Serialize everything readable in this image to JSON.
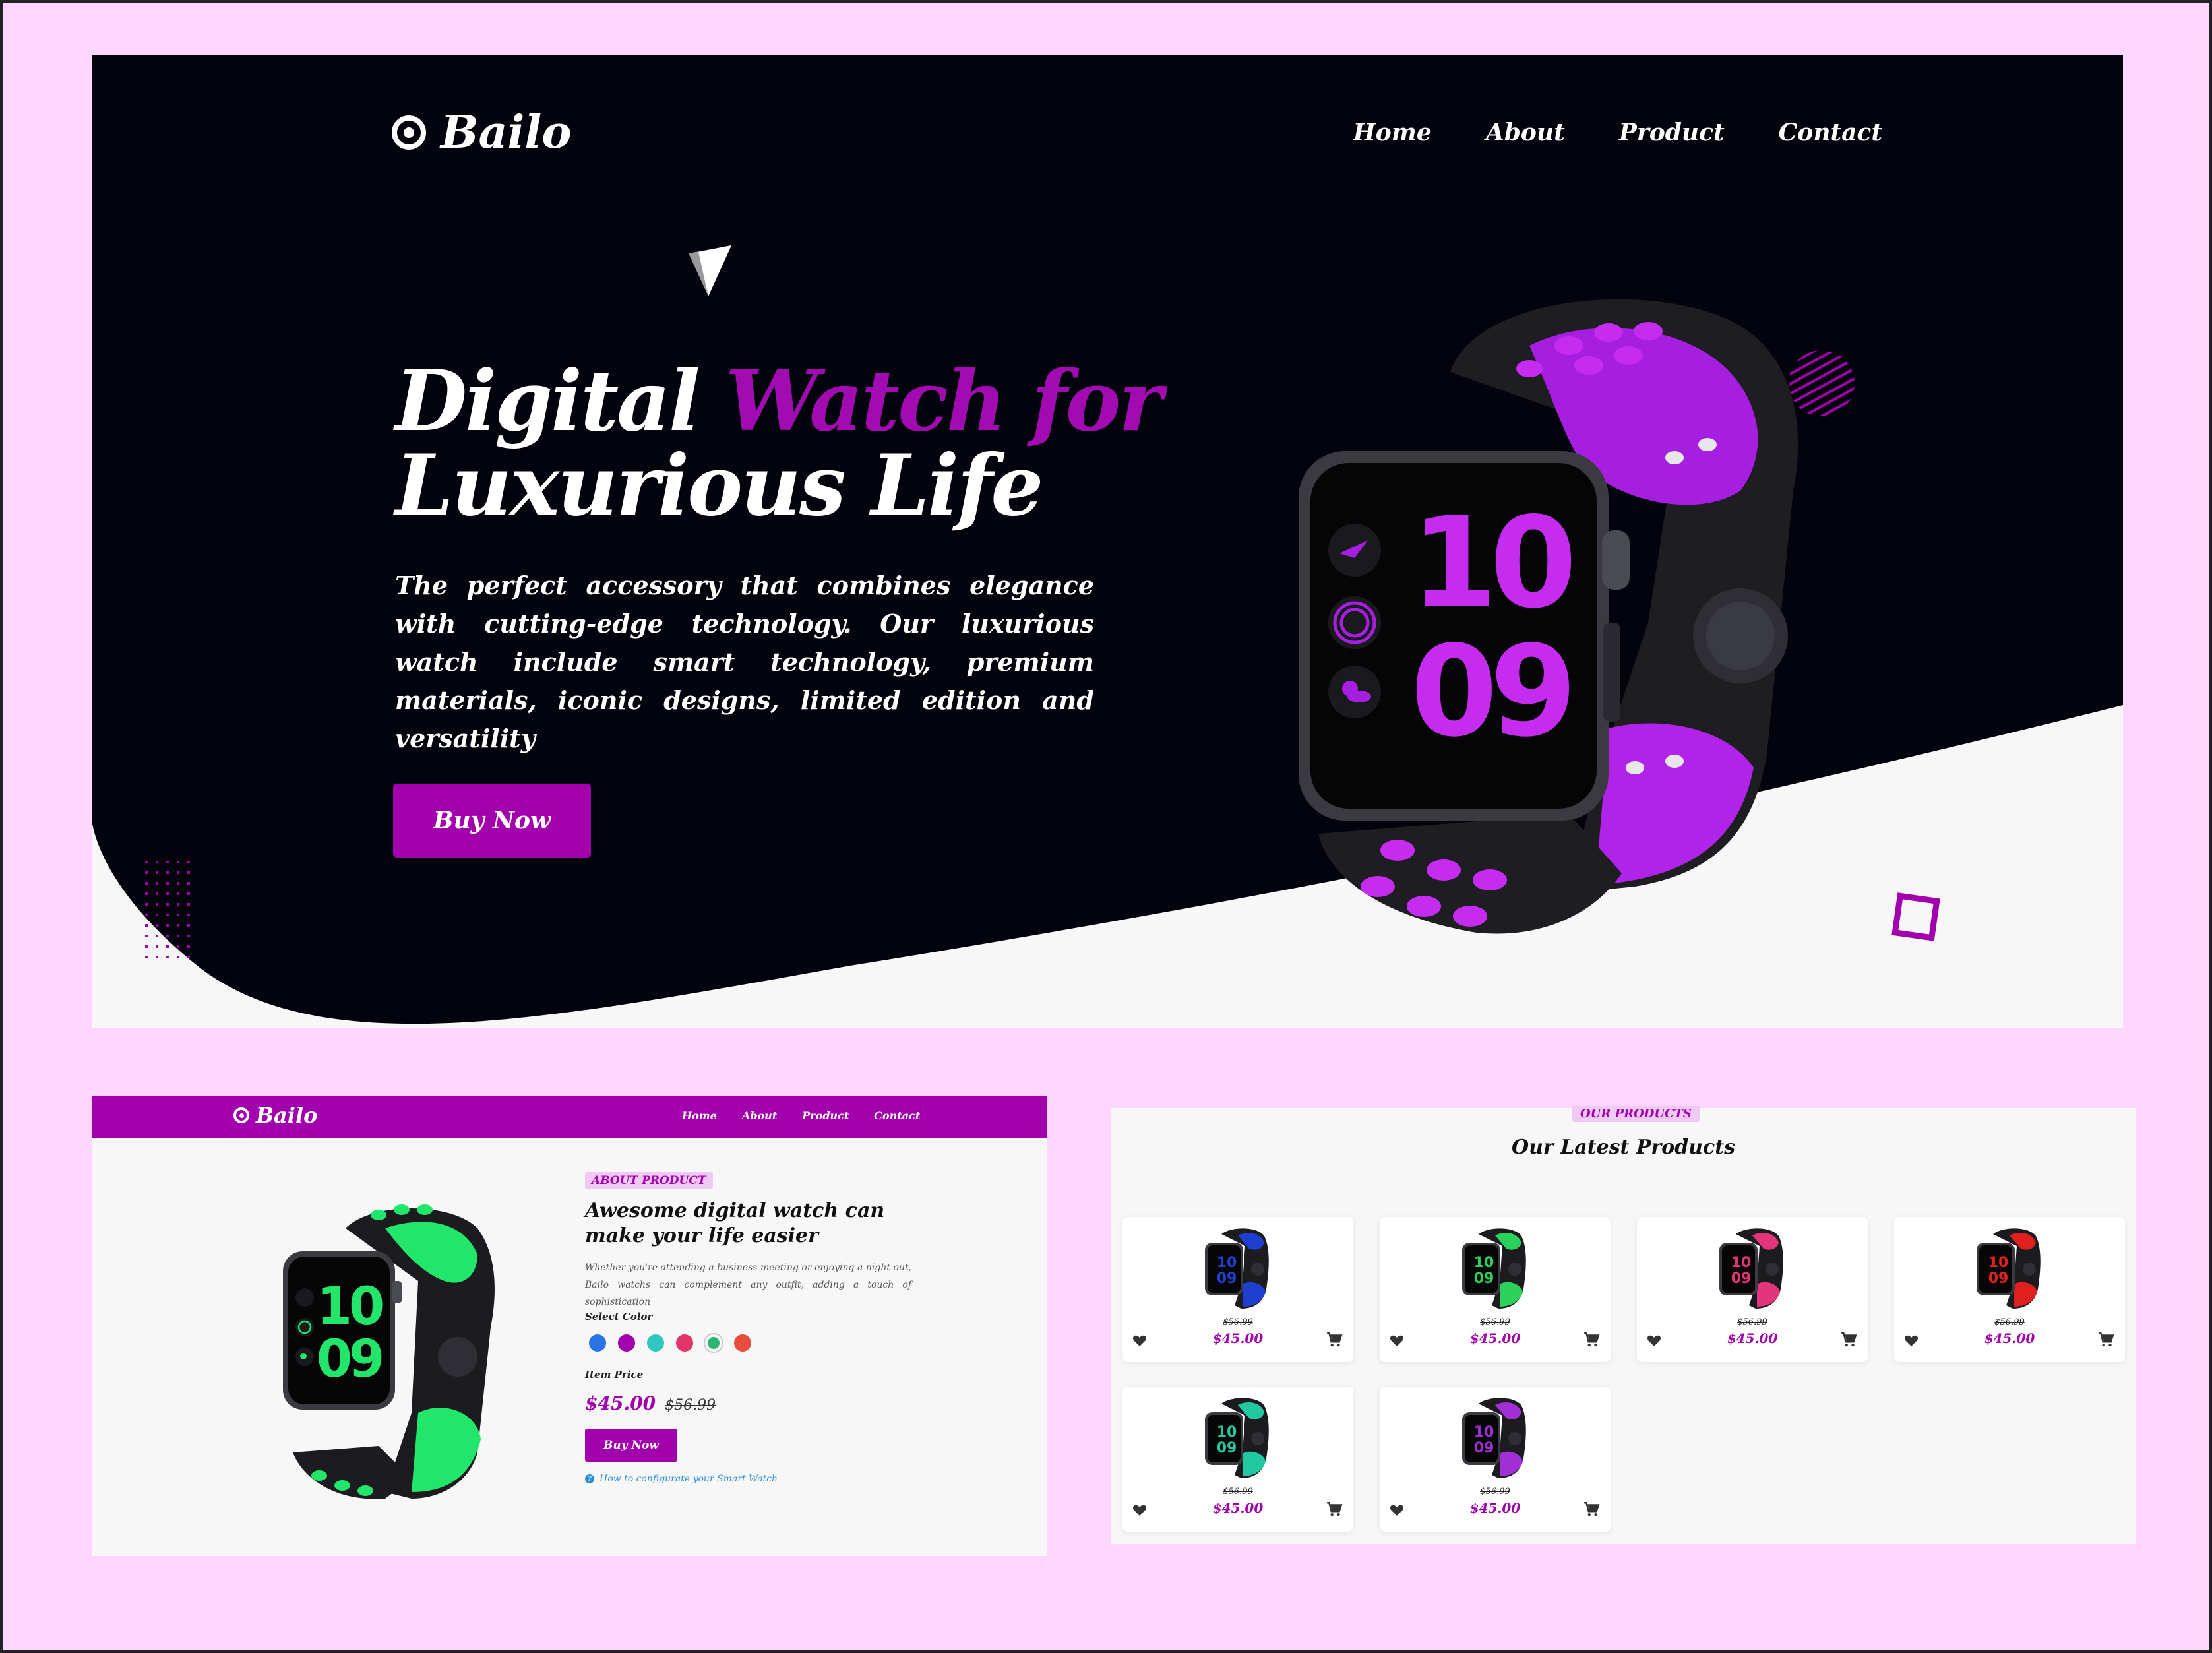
{
  "brand": {
    "name": "Bailo"
  },
  "nav": {
    "home": "Home",
    "about": "About",
    "product": "Product",
    "contact": "Contact"
  },
  "hero": {
    "title_part1": "Digital",
    "title_accent": "Watch for",
    "title_part2": "Luxurious Life",
    "description": "The perfect accessory that combines elegance with cutting-edge technology. Our luxurious watch include smart technology, premium materials, iconic designs, limited edition and versatility",
    "button": "Buy Now",
    "watch_time_hours": "10",
    "watch_time_minutes": "09"
  },
  "about": {
    "tag": "ABOUT PRODUCT",
    "heading": "Awesome digital watch can make your life easier",
    "text": "Whether you're attending a business meeting or enjoying a night out, Bailo watchs can complement any outfit, adding a touch of sophistication",
    "select_color_label": "Select Color",
    "colors": [
      "#2b73e6",
      "#a300ad",
      "#2fc9c0",
      "#e2356a",
      "#2bb673",
      "#e84c3d"
    ],
    "item_price_label": "Item Price",
    "price": "$45.00",
    "old_price": "$56.99",
    "button": "Buy Now",
    "help_link": "How to configurate your Smart Watch",
    "watch_time_hours": "10",
    "watch_time_minutes": "09"
  },
  "products": {
    "tag": "OUR PRODUCTS",
    "heading": "Our Latest Products",
    "items": [
      {
        "old_price": "$56.99",
        "price": "$45.00",
        "color": "#1f3fd1"
      },
      {
        "old_price": "$56.99",
        "price": "$45.00",
        "color": "#2bd15a"
      },
      {
        "old_price": "$56.99",
        "price": "$45.00",
        "color": "#e2357a"
      },
      {
        "old_price": "$56.99",
        "price": "$45.00",
        "color": "#e01f1f"
      },
      {
        "old_price": "$56.99",
        "price": "$45.00",
        "color": "#22c9a0"
      },
      {
        "old_price": "$56.99",
        "price": "$45.00",
        "color": "#a22fd6"
      }
    ]
  },
  "theme": {
    "accent": "#a300ad",
    "dark": "#03030e",
    "background": "#ffd6ff"
  }
}
